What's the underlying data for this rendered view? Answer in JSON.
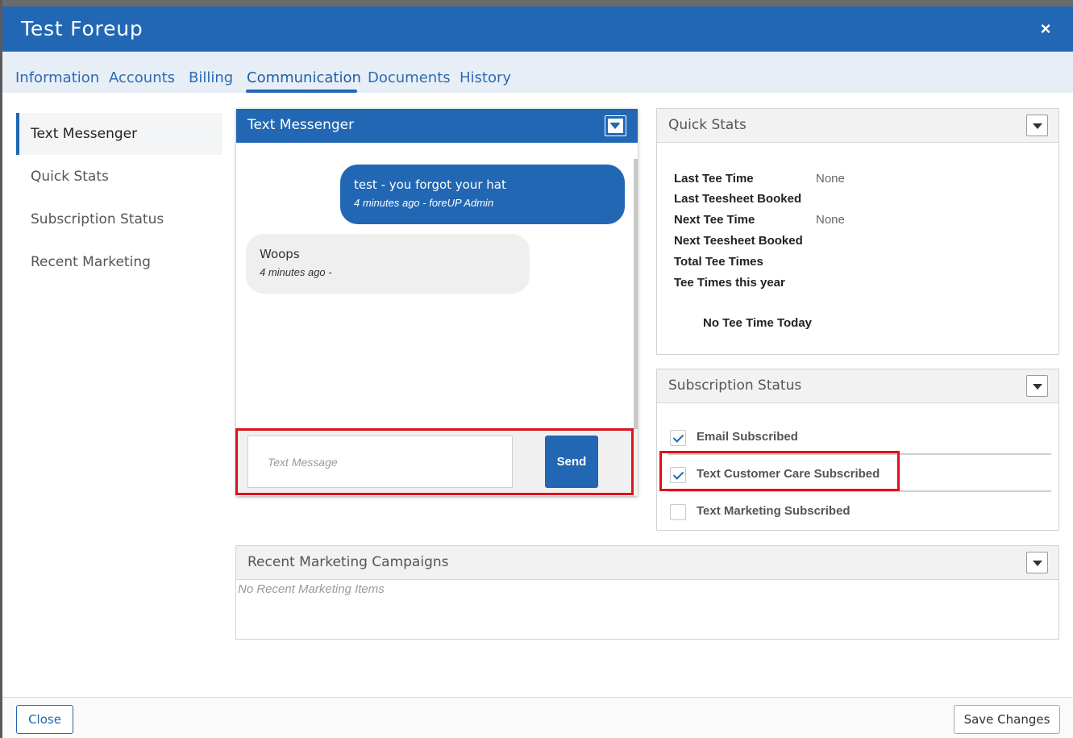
{
  "modal": {
    "title": "Test Foreup",
    "close_icon": "×"
  },
  "tabs": [
    {
      "label": "Information"
    },
    {
      "label": "Accounts"
    },
    {
      "label": "Billing"
    },
    {
      "label": "Communication",
      "active": true
    },
    {
      "label": "Documents"
    },
    {
      "label": "History"
    }
  ],
  "sidenav": {
    "items": [
      {
        "label": "Text Messenger",
        "active": true
      },
      {
        "label": "Quick Stats"
      },
      {
        "label": "Subscription Status"
      },
      {
        "label": "Recent Marketing"
      }
    ]
  },
  "messenger": {
    "title": "Text Messenger",
    "messages": [
      {
        "direction": "outgoing",
        "text": "test - you forgot your hat",
        "meta": "4 minutes ago - foreUP Admin"
      },
      {
        "direction": "incoming",
        "text": "Woops",
        "meta": "4 minutes ago -"
      }
    ],
    "input_placeholder": "Text Message",
    "input_value": "",
    "send_label": "Send"
  },
  "quick_stats": {
    "title": "Quick Stats",
    "rows": [
      {
        "label": "Last Tee Time",
        "value": "None"
      },
      {
        "label": "Last Teesheet Booked",
        "value": ""
      },
      {
        "label": "Next Tee Time",
        "value": "None"
      },
      {
        "label": "Next Teesheet Booked",
        "value": ""
      },
      {
        "label": "Total Tee Times",
        "value": ""
      },
      {
        "label": "Tee Times this year",
        "value": ""
      }
    ],
    "note": "No Tee Time Today"
  },
  "subscription": {
    "title": "Subscription Status",
    "items": [
      {
        "label": "Email Subscribed",
        "checked": true
      },
      {
        "label": "Text Customer Care Subscribed",
        "checked": true
      },
      {
        "label": "Text Marketing Subscribed",
        "checked": false
      }
    ]
  },
  "recent_marketing": {
    "title": "Recent Marketing Campaigns",
    "empty_text": "No Recent Marketing Items"
  },
  "footer": {
    "close_label": "Close",
    "save_label": "Save Changes"
  },
  "colors": {
    "primary": "#2167b4",
    "highlight": "#e0101a",
    "tab_bar": "#e8eef6"
  }
}
